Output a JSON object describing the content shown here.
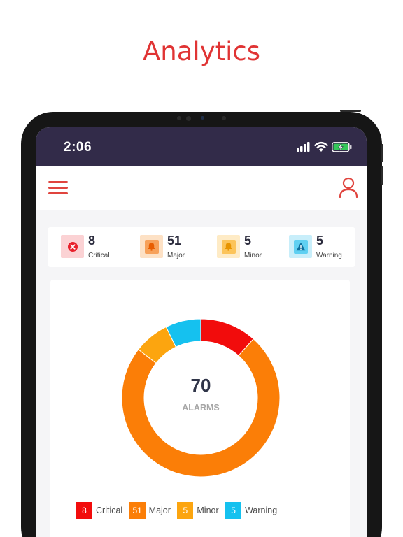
{
  "headline": "Analytics",
  "status_bar": {
    "time": "2:06"
  },
  "summary": [
    {
      "key": "critical",
      "count": "8",
      "label": "Critical",
      "icon": "close-circle-icon",
      "color": "#e8202b",
      "bg": "#fbd2d4"
    },
    {
      "key": "major",
      "count": "51",
      "label": "Major",
      "icon": "bell-icon",
      "color": "#f57c00",
      "bg": "#fde1c5"
    },
    {
      "key": "minor",
      "count": "5",
      "label": "Minor",
      "icon": "bell-icon",
      "color": "#f5a400",
      "bg": "#feebc6"
    },
    {
      "key": "warning",
      "count": "5",
      "label": "Warning",
      "icon": "warning-triangle-icon",
      "color": "#14b5e6",
      "bg": "#c8eefa"
    }
  ],
  "chart_data": {
    "type": "pie",
    "categories": [
      "Critical",
      "Major",
      "Minor",
      "Warning"
    ],
    "values": [
      8,
      51,
      5,
      5
    ],
    "colors": [
      "#f20c0c",
      "#fb7e07",
      "#fca50f",
      "#15c1ef"
    ],
    "center_value": "70",
    "center_label": "ALARMS",
    "start": "top",
    "direction": "clockwise"
  },
  "legend": [
    {
      "count": "8",
      "label": "Critical",
      "color": "#f20c0c"
    },
    {
      "count": "51",
      "label": "Major",
      "color": "#fb7e07"
    },
    {
      "count": "5",
      "label": "Minor",
      "color": "#fca50f"
    },
    {
      "count": "5",
      "label": "Warning",
      "color": "#15c1ef"
    }
  ]
}
